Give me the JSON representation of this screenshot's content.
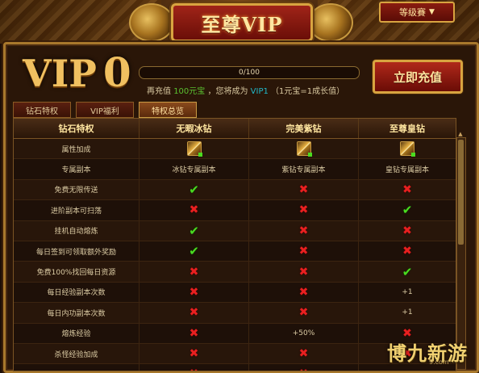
{
  "header": {
    "title": "至尊VIP",
    "tag_label": "等级賽",
    "tag_dropdown": "▼"
  },
  "vip": {
    "label": "VIP",
    "level": "0",
    "progress_text": "0/100",
    "progress_fraction": 0.0,
    "recharge_prefix": "再充值",
    "recharge_amount": "100元宝",
    "recharge_mid": "，您将成为",
    "recharge_target": "VIP1",
    "recharge_suffix": "（1元宝=1成长值）",
    "recharge_button": "立即充值"
  },
  "tabs": [
    {
      "label": "钻石特权",
      "active": false
    },
    {
      "label": "VIP福利",
      "active": false
    },
    {
      "label": "特权总览",
      "active": true
    }
  ],
  "table": {
    "headers": [
      "钻石特权",
      "无暇冰钻",
      "完美紫钻",
      "至尊皇钻"
    ],
    "rows": [
      {
        "name": "属性加成",
        "c1": "icon",
        "c2": "icon",
        "c3": "icon"
      },
      {
        "name": "专属副本",
        "c1": "冰钻专属副本",
        "c2": "紫钻专属副本",
        "c3": "皇钻专属副本"
      },
      {
        "name": "免费无限传送",
        "c1": "check",
        "c2": "cross",
        "c3": "cross"
      },
      {
        "name": "进阶副本可扫荡",
        "c1": "cross",
        "c2": "cross",
        "c3": "check"
      },
      {
        "name": "挂机自动熔炼",
        "c1": "check",
        "c2": "cross",
        "c3": "cross"
      },
      {
        "name": "每日签到可领取额外奖励",
        "c1": "check",
        "c2": "cross",
        "c3": "cross"
      },
      {
        "name": "免费100%找回每日资源",
        "c1": "cross",
        "c2": "cross",
        "c3": "check"
      },
      {
        "name": "每日经验副本次数",
        "c1": "cross",
        "c2": "cross",
        "c3": "+1"
      },
      {
        "name": "每日内功副本次数",
        "c1": "cross",
        "c2": "cross",
        "c3": "+1"
      },
      {
        "name": "熔炼经验",
        "c1": "cross",
        "c2": "+50%",
        "c3": "cross"
      },
      {
        "name": "杀怪经验加成",
        "c1": "cross",
        "c2": "cross",
        "c3": "cross"
      },
      {
        "name": "",
        "c1": "cross",
        "c2": "cross",
        "c3": ""
      }
    ]
  },
  "icons": {
    "check": "✔",
    "cross": "✖"
  },
  "scroll_up": "▲",
  "watermark": {
    "text": "博九新游",
    "sub": "9.com"
  },
  "colors": {
    "check": "#4adc20",
    "cross": "#e82020",
    "gold": "#d8a440"
  }
}
